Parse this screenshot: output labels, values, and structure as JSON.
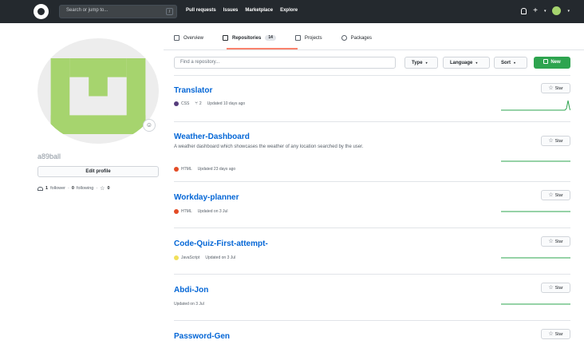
{
  "header": {
    "search_placeholder": "Search or jump to...",
    "search_key": "/",
    "nav": [
      "Pull requests",
      "Issues",
      "Marketplace",
      "Explore"
    ],
    "plus": "+"
  },
  "tabs": [
    {
      "label": "Overview",
      "icon": "book-icon"
    },
    {
      "label": "Repositories",
      "count": "14",
      "icon": "repo-icon",
      "active": true
    },
    {
      "label": "Projects",
      "icon": "project-icon"
    },
    {
      "label": "Packages",
      "icon": "package-icon"
    }
  ],
  "profile": {
    "username": "a89ball",
    "edit_label": "Edit profile",
    "followers_count": "1",
    "followers_label": "follower",
    "following_count": "0",
    "following_label": "following",
    "stars_count": "0",
    "sep": "·",
    "avatar_color": "#a6d46e"
  },
  "toolbar": {
    "find_placeholder": "Find a repository...",
    "type_label": "Type",
    "language_label": "Language",
    "sort_label": "Sort",
    "new_label": "New",
    "caret": "▾"
  },
  "star_label": "Star",
  "repos": [
    {
      "name": "Translator",
      "language": "CSS",
      "lang_color": "#563d7c",
      "forks": "2",
      "updated": "Updated 10 days ago"
    },
    {
      "name": "Weather-Dashboard",
      "description": "A weather dashboard which showcases the weather of any location searched by the user.",
      "language": "HTML",
      "lang_color": "#e34c26",
      "updated": "Updated 23 days ago"
    },
    {
      "name": "Workday-planner",
      "language": "HTML",
      "lang_color": "#e34c26",
      "updated": "Updated on 3 Jul"
    },
    {
      "name": "Code-Quiz-First-attempt-",
      "language": "JavaScript",
      "lang_color": "#f1e05a",
      "updated": "Updated on 3 Jul"
    },
    {
      "name": "Abdi-Jon",
      "updated": "Updated on 3 Jul"
    },
    {
      "name": "Password-Gen"
    }
  ],
  "colors": {
    "accent": "#0366d6",
    "new_button": "#2ea44f",
    "tab_underline": "#f9826c",
    "sparkline": "#2ea44f"
  }
}
